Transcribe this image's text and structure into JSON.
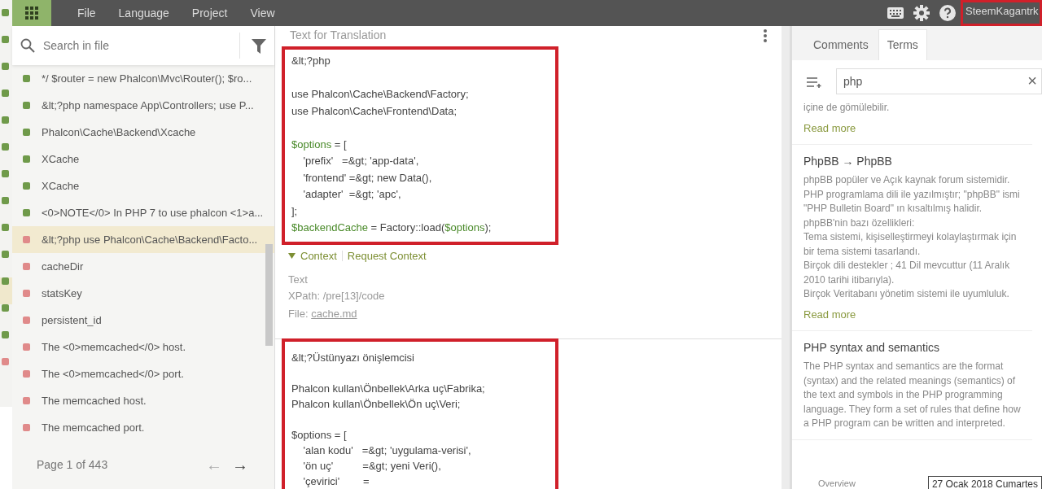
{
  "menu": [
    "File",
    "Language",
    "Project",
    "View"
  ],
  "user": {
    "name": "SteemKagantrk",
    "highlighted": true
  },
  "underlying_strip": [
    {
      "color": "#6f9a4a",
      "selected": false
    },
    {
      "color": "#6f9a4a",
      "selected": false
    },
    {
      "color": "#6f9a4a",
      "selected": false
    },
    {
      "color": "#6f9a4a",
      "selected": false
    },
    {
      "color": "#6f9a4a",
      "selected": false
    },
    {
      "color": "#6f9a4a",
      "selected": false
    },
    {
      "color": "#6f9a4a",
      "selected": false
    },
    {
      "color": "#6f9a4a",
      "selected": false
    },
    {
      "color": "#6f9a4a",
      "selected": false
    },
    {
      "color": "#6f9a4a",
      "selected": false
    },
    {
      "color": "#6f9a4a",
      "selected": true
    },
    {
      "color": "#6f9a4a",
      "selected": false
    },
    {
      "color": "#6f9a4a",
      "selected": false
    },
    {
      "color": "#e08a8a",
      "selected": false
    }
  ],
  "file_search": {
    "placeholder": "Search in file"
  },
  "strings": [
    {
      "text": "*/ $router = new Phalcon\\Mvc\\Router(); $ro...",
      "color": "#6f9a4a",
      "selected": false
    },
    {
      "text": "&lt;?php namespace App\\Controllers; use P...",
      "color": "#6f9a4a",
      "selected": false
    },
    {
      "text": "Phalcon\\Cache\\Backend\\Xcache",
      "color": "#6f9a4a",
      "selected": false
    },
    {
      "text": "XCache",
      "color": "#6f9a4a",
      "selected": false
    },
    {
      "text": "XCache",
      "color": "#6f9a4a",
      "selected": false
    },
    {
      "text": "<0>NOTE</0> In PHP 7 to use phalcon <1>a...",
      "color": "#6f9a4a",
      "selected": false
    },
    {
      "text": "&lt;?php use Phalcon\\Cache\\Backend\\Facto...",
      "color": "#e08a8a",
      "selected": true
    },
    {
      "text": "cacheDir",
      "color": "#e08a8a",
      "selected": false
    },
    {
      "text": "statsKey",
      "color": "#e08a8a",
      "selected": false
    },
    {
      "text": "persistent_id",
      "color": "#e08a8a",
      "selected": false
    },
    {
      "text": "The <0>memcached</0> host.",
      "color": "#e08a8a",
      "selected": false
    },
    {
      "text": "The <0>memcached</0> port.",
      "color": "#e08a8a",
      "selected": false
    },
    {
      "text": "The memcached host.",
      "color": "#e08a8a",
      "selected": false
    },
    {
      "text": "The memcached port.",
      "color": "#e08a8a",
      "selected": false
    }
  ],
  "pager": {
    "label": "Page 1 of 443",
    "prev": "←",
    "next": "→",
    "prev_disabled": true,
    "next_disabled": false
  },
  "editor": {
    "title": "Text for Translation",
    "source": {
      "highlighted": true,
      "paragraphs": [
        [
          [
            {
              "text": "&lt;?php",
              "kind": "plain"
            }
          ]
        ],
        [
          [
            {
              "text": "use Phalcon\\Cache\\Backend\\Factory;",
              "kind": "plain"
            }
          ],
          [
            {
              "text": "use Phalcon\\Cache\\Frontend\\Data;",
              "kind": "plain"
            }
          ]
        ],
        [
          [
            {
              "text": "$options",
              "kind": "var"
            },
            {
              "text": " = [",
              "kind": "plain"
            }
          ],
          [
            {
              "text": "    'prefix'   =&gt; 'app-data',",
              "kind": "plain"
            }
          ],
          [
            {
              "text": "    'frontend' =&gt; new Data(),",
              "kind": "plain"
            }
          ],
          [
            {
              "text": "    'adapter'  =&gt; 'apc',",
              "kind": "plain"
            }
          ],
          [
            {
              "text": "];",
              "kind": "plain"
            }
          ],
          [
            {
              "text": "$backendCache",
              "kind": "var"
            },
            {
              "text": " = Factory::load(",
              "kind": "plain"
            },
            {
              "text": "$options",
              "kind": "var"
            },
            {
              "text": ");",
              "kind": "plain"
            }
          ]
        ]
      ]
    },
    "context_links": [
      {
        "label": "Context",
        "expanded": true
      },
      {
        "label": "Request Context"
      }
    ],
    "context": {
      "type": "Text",
      "xpath": "XPath: /pre[13]/code",
      "file_label": "File:",
      "file": "cache.md"
    },
    "translation": {
      "highlighted": true,
      "paragraphs": [
        [
          "&lt;?Üstünyazı önişlemcisi"
        ],
        [
          "Phalcon kullan\\Önbellek\\Arka uç\\Fabrika;",
          "Phalcon kullan\\Önbellek\\Ön uç\\Veri;"
        ],
        [
          "$options = [",
          "    'alan kodu'   =&gt; 'uygulama-verisi',",
          "    'ön uç'          =&gt; yeni Veri(),",
          "    'çevirici'        ="
        ]
      ]
    }
  },
  "side_tabs": [
    {
      "label": "Comments",
      "selected": false
    },
    {
      "label": "Terms",
      "selected": true
    }
  ],
  "term_search": {
    "value": "php",
    "clear": "×"
  },
  "terms": [
    {
      "description": [
        "içine de gömülebilir."
      ],
      "read_more": "Read more"
    },
    {
      "title": "PhpBB → PhpBB",
      "description": [
        "phpBB popüler ve Açık kaynak forum sistemidir. PHP programlama dili ile yazılmıştır; \"phpBB\" ismi \"PHP Bulletin Board\" ın kısaltılmış halidir.",
        "phpBB'nin bazı özellikleri:",
        "Tema sistemi, kişiselleştirmeyi kolaylaştırmak için bir tema sistemi tasarlandı.",
        "Birçok dili destekler ; 41 Dil mevcuttur (11 Aralık 2010 tarihi itibarıyla).",
        "Birçok Veritabanı yönetim sistemi ile uyumluluk."
      ],
      "read_more": "Read more"
    },
    {
      "title": "PHP syntax and semantics",
      "description": [
        "The PHP syntax and semantics are the format (syntax) and the related meanings (semantics) of the text and symbols in the PHP programming language. They form a set of rules that define how a PHP program can be written and interpreted."
      ]
    }
  ],
  "bottom_tab": "Overview",
  "date_tooltip": "27 Ocak 2018 Cumartes"
}
